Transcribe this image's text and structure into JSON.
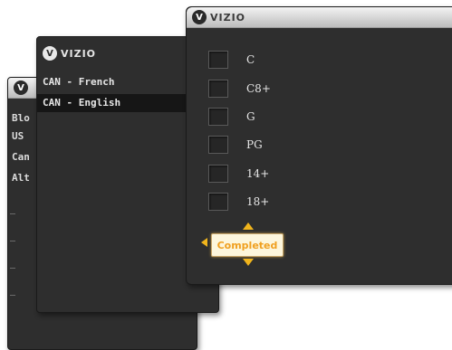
{
  "brand": {
    "badge": "V",
    "wordmark": "VIZIO"
  },
  "back_panel": {
    "items": [
      "Blo",
      "US",
      "Can",
      "Alt"
    ]
  },
  "middle_panel": {
    "items": [
      {
        "label": "CAN - French",
        "selected": false
      },
      {
        "label": "CAN - English",
        "selected": true
      }
    ]
  },
  "front_panel": {
    "ratings": [
      {
        "label": "C",
        "checked": false
      },
      {
        "label": "C8+",
        "checked": false
      },
      {
        "label": "G",
        "checked": false
      },
      {
        "label": "PG",
        "checked": false
      },
      {
        "label": "14+",
        "checked": false
      },
      {
        "label": "18+",
        "checked": false
      }
    ],
    "completed_label": "Completed"
  },
  "colors": {
    "panel_bg": "#2e2e2e",
    "accent": "#f0b41c",
    "completed_text": "#f0a020",
    "completed_bg": "#fdf6dc"
  }
}
